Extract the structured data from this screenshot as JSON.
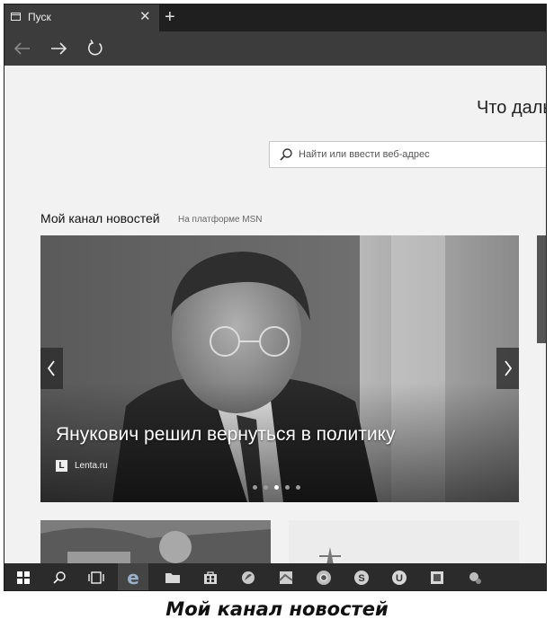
{
  "browser": {
    "tab_title": "Пуск",
    "tab_close_glyph": "✕",
    "new_tab_glyph": "+"
  },
  "nav": {
    "back_icon": "arrow-left-icon",
    "forward_icon": "arrow-right-icon",
    "refresh_icon": "refresh-icon"
  },
  "start_page": {
    "greeting": "Что даль",
    "search_placeholder": "Найти или ввести веб-адрес",
    "feed_title": "Мой канал новостей",
    "feed_subtitle": "На платформе MSN"
  },
  "hero": {
    "headline": "Янукович решил вернуться в политику",
    "source_logo": "L",
    "source_name": "Lenta.ru",
    "slide_count": 5,
    "active_slide": 3
  },
  "taskbar": {
    "items": [
      {
        "name": "windows-start-icon"
      },
      {
        "name": "search-icon"
      },
      {
        "name": "task-view-icon"
      },
      {
        "name": "edge-icon"
      },
      {
        "name": "file-explorer-icon"
      },
      {
        "name": "store-icon"
      },
      {
        "name": "app-icon"
      },
      {
        "name": "maps-icon"
      },
      {
        "name": "chrome-icon"
      },
      {
        "name": "skype-icon"
      },
      {
        "name": "uplay-icon"
      },
      {
        "name": "publisher-icon"
      },
      {
        "name": "settings-app-icon"
      }
    ]
  },
  "caption": "Мой канал новостей",
  "colors": {
    "titlebar": "#1f1f1f",
    "tab_active": "#3c3c3c",
    "page_bg": "#f2f2f2",
    "taskbar": "#2b2b2b"
  }
}
